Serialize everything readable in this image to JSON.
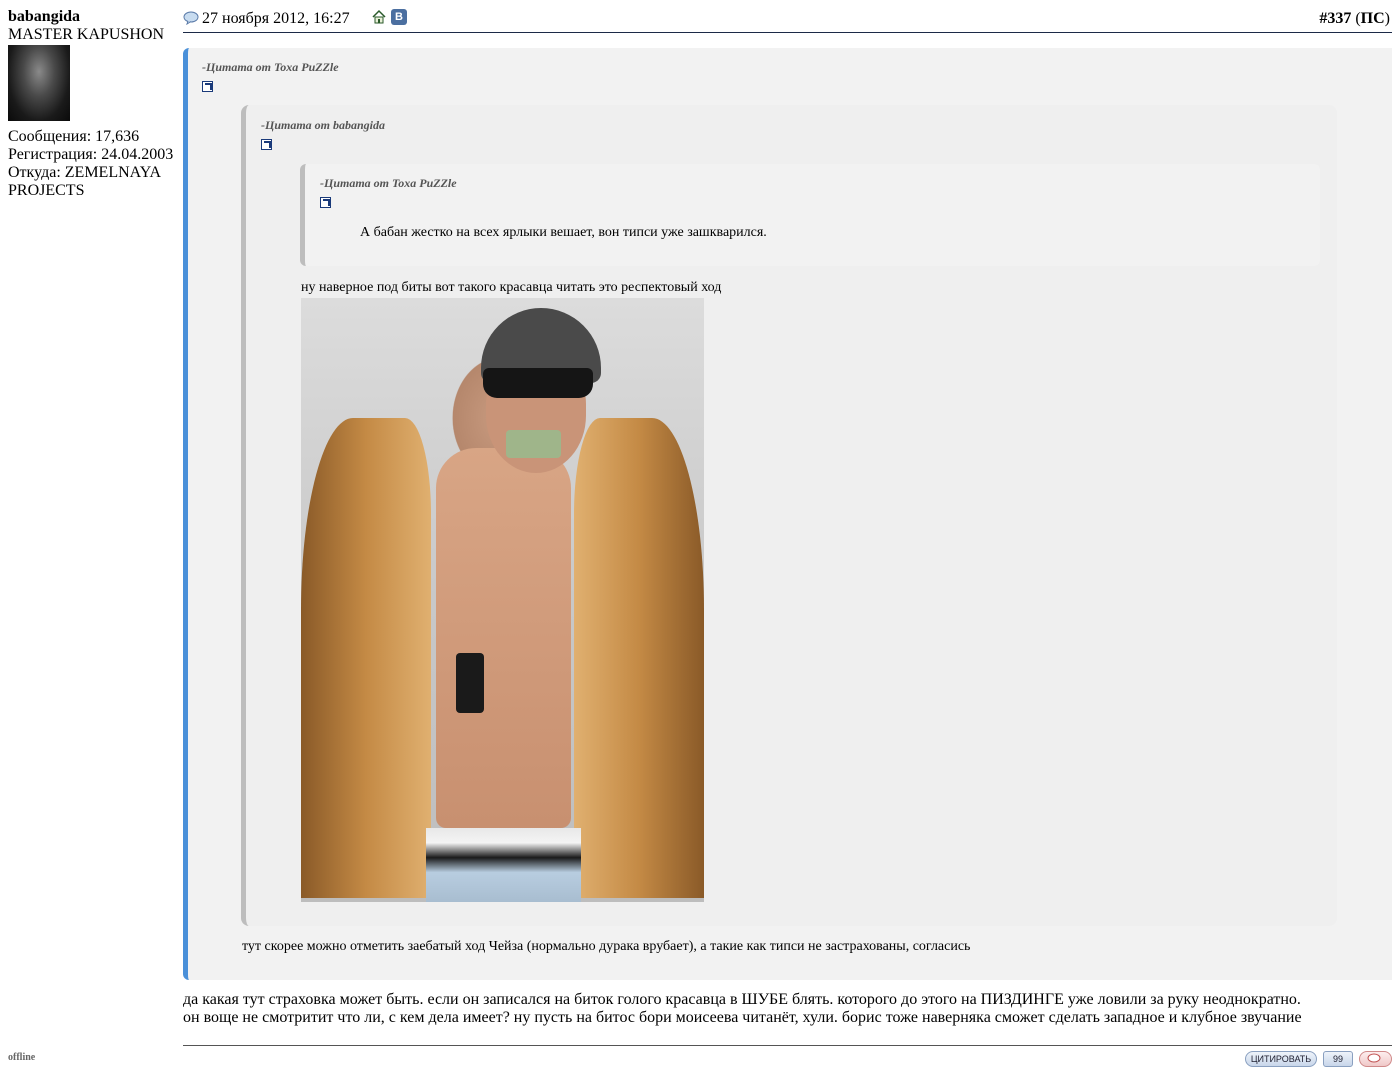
{
  "author": {
    "username": "babangida",
    "rank": "MASTER KAPUSHON",
    "messages": "Сообщения: 17,636",
    "registered": "Регистрация: 24.04.2003",
    "from_line1": "Откуда: ZEMELNAYA",
    "from_line2": "PROJECTS",
    "status": "offline"
  },
  "header": {
    "date": "27 ноября 2012, 16:27",
    "vk_label": "B",
    "post_number": "#337",
    "post_suffix_open": " (",
    "post_tag": "ПС",
    "post_suffix_close": ")"
  },
  "quotes": {
    "outer": {
      "header": "-Цитата от Toxa PuZZle",
      "reply": "тут скорее можно отметить заебатый ход Чейза (нормально дурака врубает), а такие как типси не застрахованы, согласись"
    },
    "middle": {
      "header": "-Цитата от babangida",
      "reply": "ну наверное под биты вот такого красавца читать это респектовый ход"
    },
    "inner": {
      "header": "-Цитата от Toxa PuZZle",
      "text": "А бабан жестко на всех ярлыки вешает, вон типси уже зашкварился."
    }
  },
  "body": {
    "line1": "да какая тут страховка может быть. если он записался на биток голого красавца в ШУБЕ блять. которого до этого на ПИЗДИНГЕ уже ловили за руку неоднократно.",
    "line2": "он воще не смотритит что ли, с кем дела имеет? ну пусть на битос бори моисеева читанёт, хули. борис тоже наверняка сможет сделать западное и клубное звучание"
  },
  "footer": {
    "quote_button": "ЦИТИРОВАТЬ",
    "multiquote_button": "99",
    "reply_button": ""
  }
}
